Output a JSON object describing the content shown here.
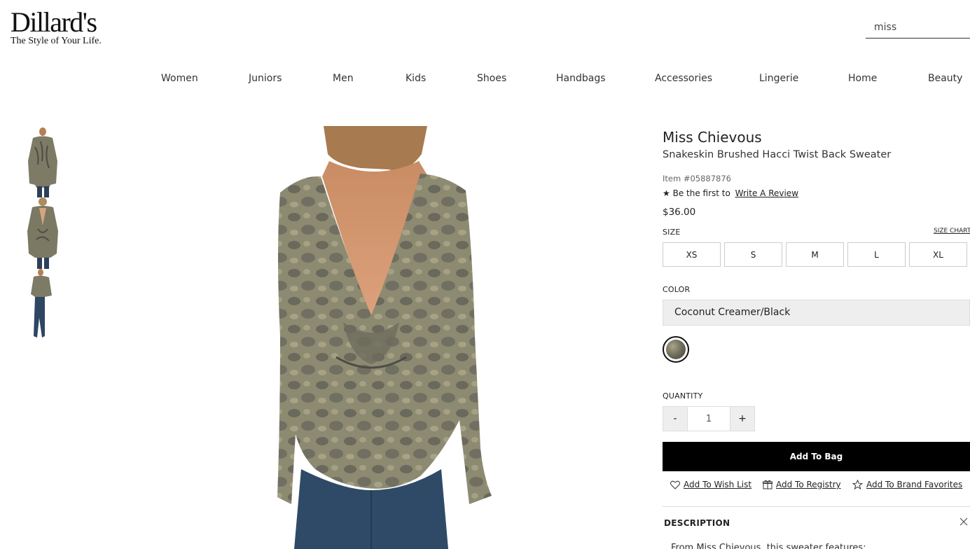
{
  "header": {
    "logo_name": "Dillard's",
    "logo_tagline": "The Style of Your Life.",
    "search_value": "miss"
  },
  "nav": {
    "items": [
      "Women",
      "Juniors",
      "Men",
      "Kids",
      "Shoes",
      "Handbags",
      "Accessories",
      "Lingerie",
      "Home",
      "Beauty"
    ]
  },
  "product": {
    "brand": "Miss Chievous",
    "name": "Snakeskin Brushed Hacci Twist Back Sweater",
    "item_number": "Item #05887876",
    "review_prefix": "Be the first to",
    "review_link": "Write A Review",
    "price": "$36.00",
    "size_label": "SIZE",
    "size_chart_label": "SIZE CHART",
    "sizes": [
      "XS",
      "S",
      "M",
      "L",
      "XL"
    ],
    "color_label": "COLOR",
    "color_value": "Coconut Creamer/Black",
    "quantity_label": "QUANTITY",
    "quantity_minus": "-",
    "quantity_plus": "+",
    "quantity_value": "1",
    "add_to_bag": "Add To Bag",
    "actions": {
      "wish_list": "Add To Wish List",
      "registry": "Add To Registry",
      "brand_favorites": "Add To Brand Favorites"
    },
    "description_label": "DESCRIPTION",
    "description_text": "From Miss Chievous, this sweater features:"
  },
  "icons": {
    "star": "star-icon",
    "heart": "heart-icon",
    "gift": "gift-icon",
    "star_outline": "star-outline-icon",
    "close": "close-icon"
  },
  "colors": {
    "button_black": "#000000",
    "select_bg": "#eeeeee",
    "border": "#cccccc"
  }
}
